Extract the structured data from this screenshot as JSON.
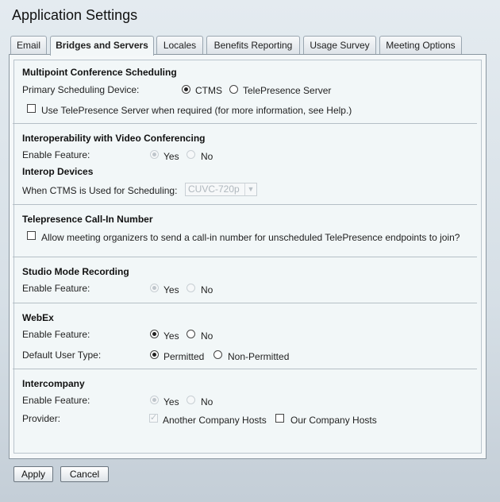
{
  "title": "Application Settings",
  "tabs": [
    "Email",
    "Bridges and Servers",
    "Locales",
    "Benefits Reporting",
    "Usage Survey",
    "Meeting Options"
  ],
  "sections": {
    "multipoint": {
      "title": "Multipoint Conference Scheduling",
      "primary_label": "Primary Scheduling Device:",
      "opt_ctms": "CTMS",
      "opt_tps": "TelePresence Server",
      "use_tps_label": "Use TelePresence Server when required (for more information, see Help.)"
    },
    "interop": {
      "title": "Interoperability with Video Conferencing",
      "enable_label": "Enable Feature:",
      "yes": "Yes",
      "no": "No",
      "devices_title": "Interop Devices",
      "ctms_label": "When CTMS is Used for Scheduling:",
      "device_value": "CUVC-720p"
    },
    "callin": {
      "title": "Telepresence Call-In Number",
      "allow_label": "Allow meeting organizers to send a call-in number for unscheduled TelePresence endpoints to join?"
    },
    "studio": {
      "title": "Studio Mode Recording",
      "enable_label": "Enable Feature:",
      "yes": "Yes",
      "no": "No"
    },
    "webex": {
      "title": "WebEx",
      "enable_label": "Enable Feature:",
      "yes": "Yes",
      "no": "No",
      "user_type_label": "Default User Type:",
      "permitted": "Permitted",
      "non_permitted": "Non-Permitted"
    },
    "intercompany": {
      "title": "Intercompany",
      "enable_label": "Enable Feature:",
      "yes": "Yes",
      "no": "No",
      "provider_label": "Provider:",
      "another": "Another Company Hosts",
      "ours": "Our Company Hosts"
    }
  },
  "buttons": {
    "apply": "Apply",
    "cancel": "Cancel"
  }
}
